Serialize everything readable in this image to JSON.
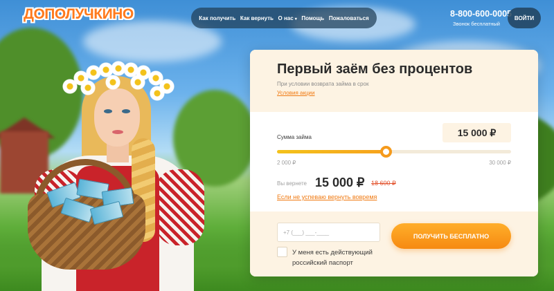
{
  "logo": {
    "text": "ДОПОЛУЧКИНО"
  },
  "nav": {
    "items": [
      "Как получить",
      "Как вернуть",
      "О нас",
      "Помощь",
      "Пожаловаться"
    ],
    "about_caret": "▾"
  },
  "contact": {
    "phone": "8-800-600-0005",
    "note": "Звонок бесплатный"
  },
  "login": {
    "label": "ВОЙТИ"
  },
  "offer": {
    "title": "Первый заём без процентов",
    "subtitle": "При условии возврата займа в срок",
    "terms_link": "Условия акции"
  },
  "loan": {
    "amount_label": "Сумма займа",
    "amount_value": "15 000 ₽",
    "min": "2 000 ₽",
    "max": "30 000 ₽",
    "min_value": 2000,
    "max_value": 30000,
    "current_value": 15000,
    "return_label": "Вы вернете",
    "return_value": "15 000 ₽",
    "return_old": "18 600 ₽",
    "late_link": "Если не успеваю вернуть вовремя"
  },
  "form": {
    "phone_placeholder": "+7 (___) ___-____",
    "submit_label": "ПОЛУЧИТЬ БЕСПЛАТНО",
    "passport_checkbox_label": "У меня есть действующий российский паспорт",
    "passport_checked": false
  },
  "colors": {
    "accent": "#f68a12",
    "nav_bg": "#203e58",
    "card_tint": "#fdf3e3",
    "strike": "#e2502a"
  }
}
